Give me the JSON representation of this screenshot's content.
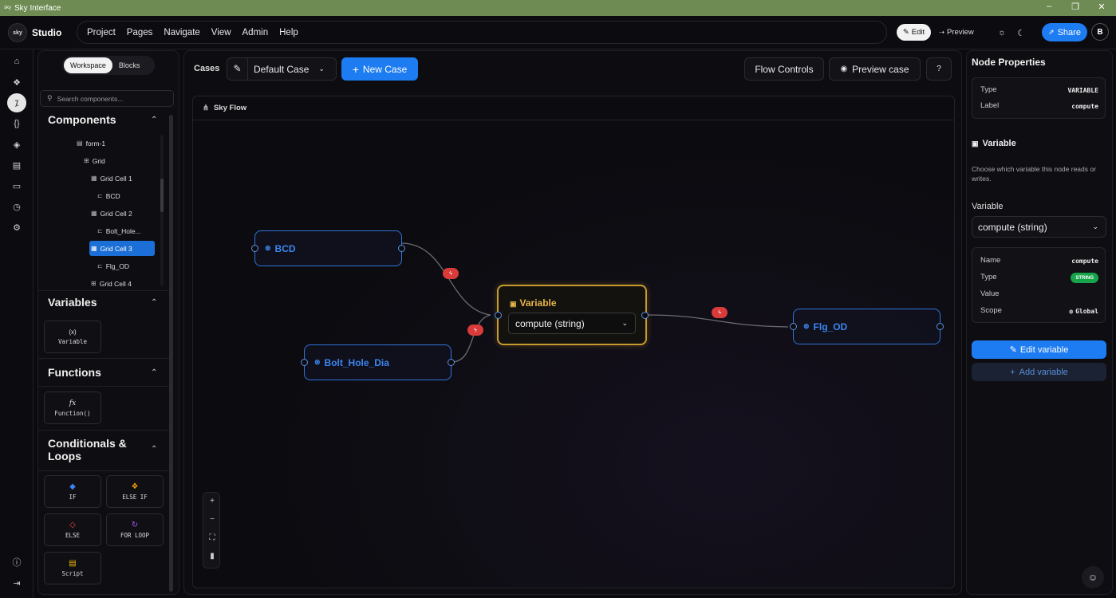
{
  "window": {
    "title": "Sky Interface",
    "logo_text": "sky"
  },
  "brand": {
    "logo": "sky",
    "name": "Studio"
  },
  "menu": [
    "Project",
    "Pages",
    "Navigate",
    "View",
    "Admin",
    "Help"
  ],
  "header": {
    "edit": "Edit",
    "preview": "Preview",
    "share": "Share",
    "avatar": "B"
  },
  "panel": {
    "tabs": [
      "Workspace",
      "Blocks"
    ],
    "search_placeholder": "Search components...",
    "components_title": "Components",
    "tree": [
      {
        "label": "form-1",
        "icon": "form-icon"
      },
      {
        "label": "Grid",
        "icon": "grid-icon"
      },
      {
        "label": "Grid Cell 1",
        "icon": "grid-cell-icon"
      },
      {
        "label": "BCD",
        "icon": "input-icon"
      },
      {
        "label": "Grid Cell 2",
        "icon": "grid-cell-icon"
      },
      {
        "label": "Bolt_Hole...",
        "icon": "input-icon"
      },
      {
        "label": "Grid Cell 3",
        "icon": "grid-cell-icon"
      },
      {
        "label": "Flg_OD",
        "icon": "input-icon"
      },
      {
        "label": "Grid Cell 4",
        "icon": "grid-cell-icon"
      }
    ],
    "variables_title": "Variables",
    "variable_card": {
      "icon": "(x)",
      "label": "Variable"
    },
    "functions_title": "Functions",
    "function_card": {
      "icon": "fx",
      "label": "Function()"
    },
    "conditionals_title_1": "Conditionals &",
    "conditionals_title_2": "Loops",
    "cond_cards": [
      {
        "label": "IF",
        "color": "#3b82f6"
      },
      {
        "label": "ELSE IF",
        "color": "#f59e0b"
      },
      {
        "label": "ELSE",
        "color": "#ef4444"
      },
      {
        "label": "FOR LOOP",
        "color": "#a855f7"
      },
      {
        "label": "Script",
        "color": "#eab308"
      }
    ]
  },
  "main": {
    "cases_label": "Cases",
    "case_select": "Default Case",
    "new_case": "New Case",
    "flow_controls": "Flow Controls",
    "preview_case": "Preview case",
    "canvas_title": "Sky Flow"
  },
  "flow": {
    "nodes": {
      "bcd": "BCD",
      "bolt": "Bolt_Hole_Dia",
      "flg": "Flg_OD"
    },
    "variable_node": {
      "title": "Variable",
      "value": "compute (string)"
    }
  },
  "props": {
    "title": "Node Properties",
    "type_label": "Type",
    "type_value": "VARIABLE",
    "label_label": "Label",
    "label_value": "compute",
    "section_title": "Variable",
    "description": "Choose which variable this node reads or writes.",
    "variable_label": "Variable",
    "variable_select": "compute (string)",
    "details": {
      "name_label": "Name",
      "name_value": "compute",
      "type_label": "Type",
      "type_value": "STRING",
      "value_label": "Value",
      "scope_label": "Scope",
      "scope_value": "Global"
    },
    "edit_variable": "Edit variable",
    "add_variable": "Add variable"
  },
  "colors": {
    "accent": "#1d7cf2",
    "node_border": "#2f73d8",
    "variable_border": "#c79a2e",
    "bolt": "#d93a3a",
    "badge": "#16a34a"
  }
}
